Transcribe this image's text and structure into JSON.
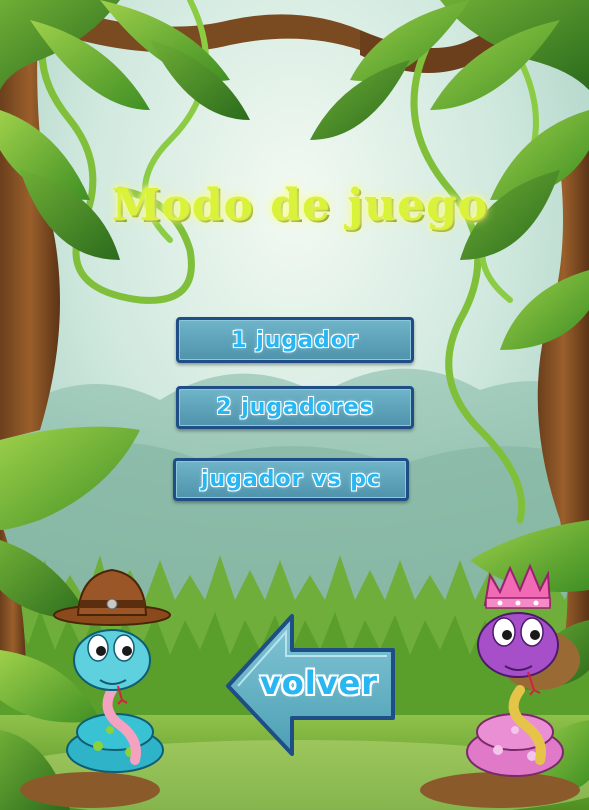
{
  "title": "Modo de juego",
  "menu": {
    "one_player": "1 Jugador",
    "two_players": "2 Jugadores",
    "vs_pc": "Jugador vs PC"
  },
  "back_label": "Volver",
  "colors": {
    "title": "#d9f23a",
    "button_fill": "#5fa5bb",
    "button_border": "#1f4e86",
    "button_text": "#2ab6f0",
    "sky": "#dff1ea",
    "grass": "#5cab2e"
  },
  "characters": {
    "left_snake": "snake-with-cowboy-hat",
    "right_snake": "snake-with-crown"
  }
}
